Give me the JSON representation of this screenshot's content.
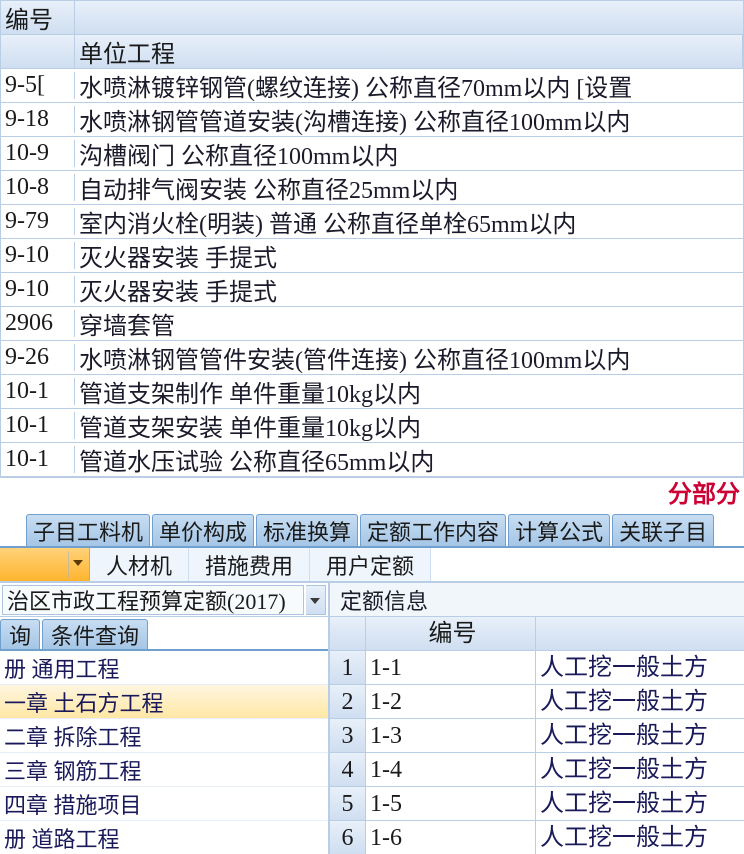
{
  "upper": {
    "header_col1": "编号",
    "header_col2": "单位工程",
    "rows": [
      {
        "code": "9-5[",
        "desc": "水喷淋镀锌钢管(螺纹连接) 公称直径70mm以内 [设置"
      },
      {
        "code": "9-18",
        "desc": "水喷淋钢管管道安装(沟槽连接) 公称直径100mm以内"
      },
      {
        "code": "10-9",
        "desc": "沟槽阀门 公称直径100mm以内"
      },
      {
        "code": "10-8",
        "desc": "自动排气阀安装 公称直径25mm以内"
      },
      {
        "code": "9-79",
        "desc": "室内消火栓(明装) 普通 公称直径单栓65mm以内"
      },
      {
        "code": "9-10",
        "desc": "灭火器安装 手提式"
      },
      {
        "code": "9-10",
        "desc": "灭火器安装 手提式"
      },
      {
        "code": "2906",
        "desc": "穿墙套管"
      },
      {
        "code": "9-26",
        "desc": "水喷淋钢管管件安装(管件连接) 公称直径100mm以内"
      },
      {
        "code": "10-1",
        "desc": "管道支架制作 单件重量10kg以内"
      },
      {
        "code": "10-1",
        "desc": "管道支架安装 单件重量10kg以内"
      },
      {
        "code": "10-1",
        "desc": "管道水压试验 公称直径65mm以内"
      }
    ]
  },
  "section_label": "分部分",
  "tabs": {
    "items": [
      "子目工料机",
      "单价构成",
      "标准换算",
      "定额工作内容",
      "计算公式",
      "关联子目"
    ]
  },
  "toolbar": {
    "btn_source": "人材机",
    "btn_measure": "措施费用",
    "btn_user": "用户定额"
  },
  "lowerLeft": {
    "dropdown_value": "治区市政工程预算定额(2017)",
    "query_tab_a": "询",
    "query_tab_b": "条件查询",
    "tree": [
      {
        "text": "册 通用工程",
        "selected": false
      },
      {
        "text": "一章 土石方工程",
        "selected": true
      },
      {
        "text": "二章 拆除工程",
        "selected": false
      },
      {
        "text": "三章 钢筋工程",
        "selected": false
      },
      {
        "text": "四章 措施项目",
        "selected": false
      },
      {
        "text": "册 道路工程",
        "selected": false
      }
    ]
  },
  "lowerRight": {
    "title": "定额信息",
    "header_code": "编号",
    "rows": [
      {
        "n": "1",
        "code": "1-1",
        "name": "人工挖一般土方"
      },
      {
        "n": "2",
        "code": "1-2",
        "name": "人工挖一般土方"
      },
      {
        "n": "3",
        "code": "1-3",
        "name": "人工挖一般土方"
      },
      {
        "n": "4",
        "code": "1-4",
        "name": "人工挖一般土方"
      },
      {
        "n": "5",
        "code": "1-5",
        "name": "人工挖一般土方"
      },
      {
        "n": "6",
        "code": "1-6",
        "name": "人工挖一般土方"
      }
    ]
  }
}
